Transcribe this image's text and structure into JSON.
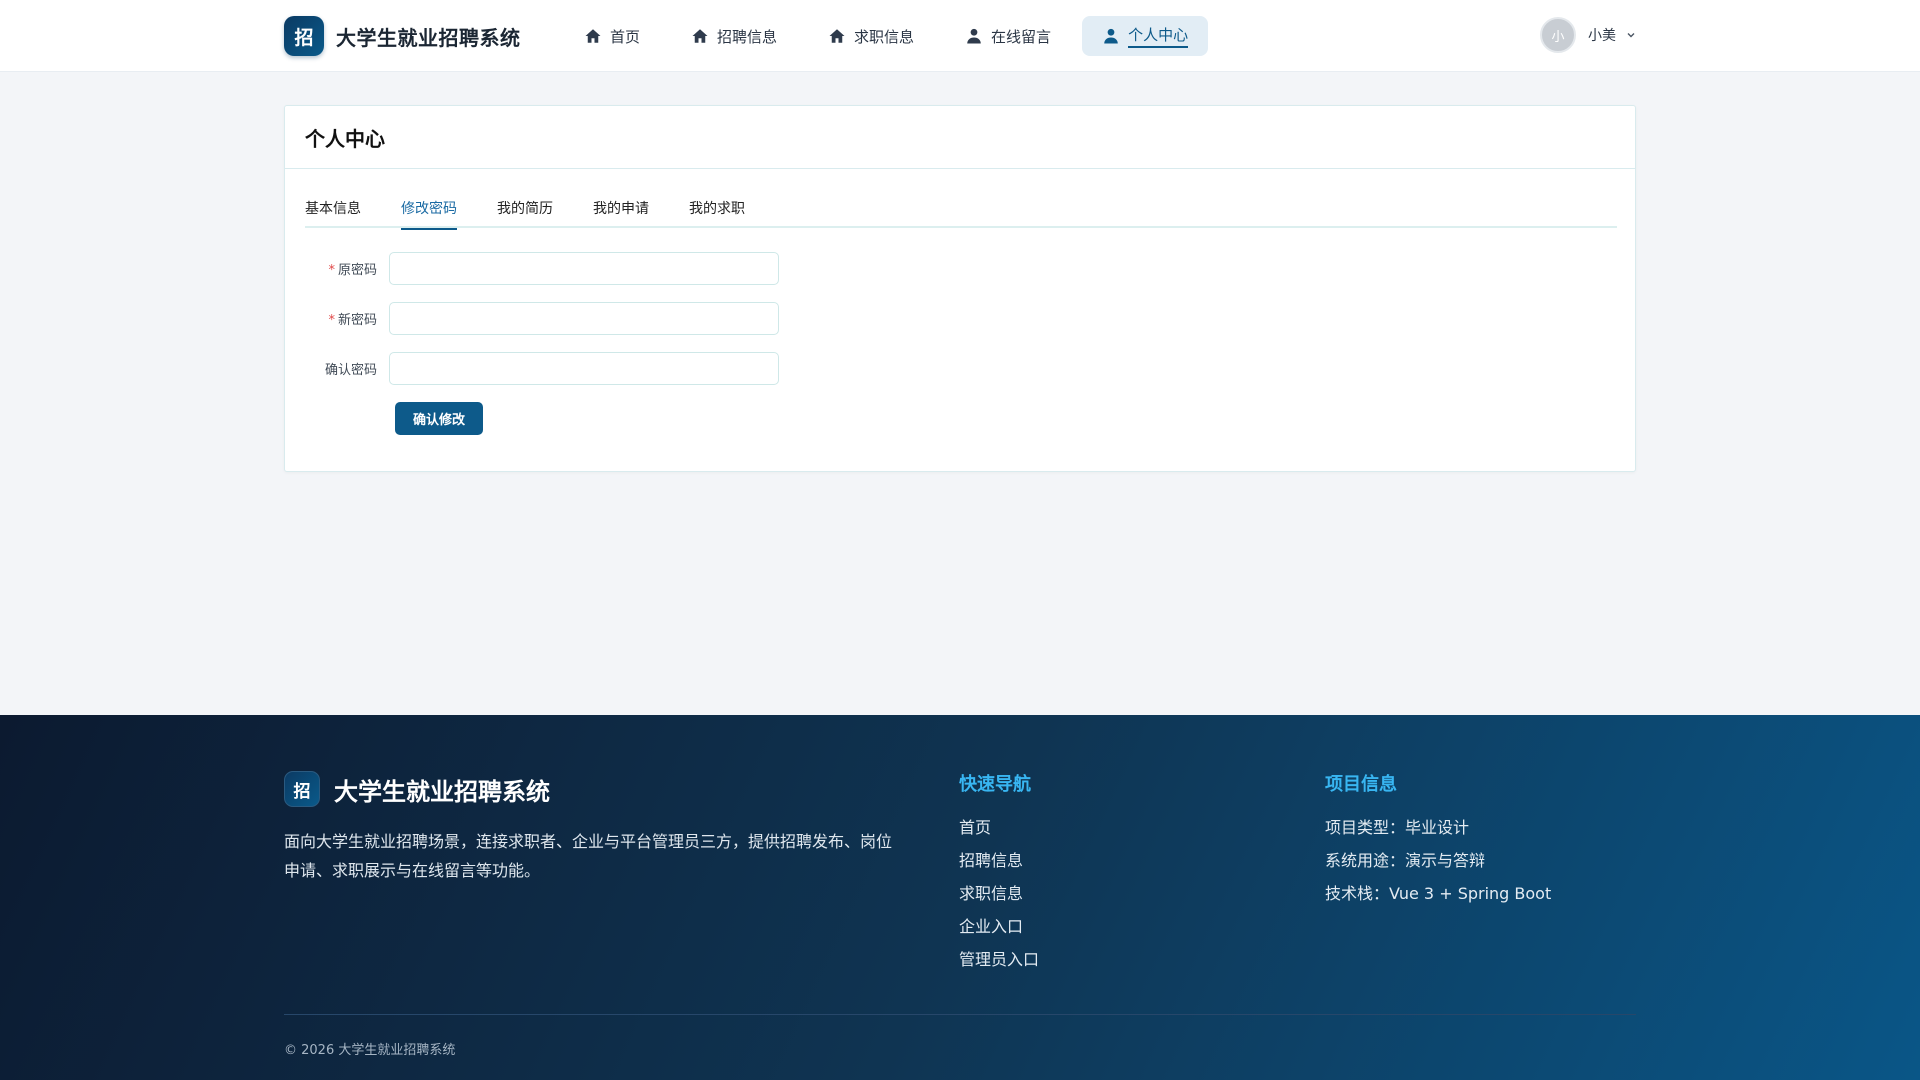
{
  "header": {
    "logo_char": "招",
    "brand": "大学生就业招聘系统",
    "nav": [
      {
        "label": "首页",
        "icon": "home-icon"
      },
      {
        "label": "招聘信息",
        "icon": "home-icon"
      },
      {
        "label": "求职信息",
        "icon": "home-icon"
      },
      {
        "label": "在线留言",
        "icon": "user-icon"
      },
      {
        "label": "个人中心",
        "icon": "user-icon",
        "active": true
      }
    ],
    "user": {
      "avatar_char": "小",
      "name": "小美"
    }
  },
  "card": {
    "title": "个人中心",
    "tabs": [
      {
        "label": "基本信息"
      },
      {
        "label": "修改密码",
        "active": true
      },
      {
        "label": "我的简历"
      },
      {
        "label": "我的申请"
      },
      {
        "label": "我的求职"
      }
    ],
    "form": {
      "old_password_label": "原密码",
      "new_password_label": "新密码",
      "confirm_password_label": "确认密码",
      "required_mark": "*",
      "old_password_value": "",
      "new_password_value": "",
      "confirm_password_value": "",
      "submit_label": "确认修改"
    }
  },
  "footer": {
    "logo_char": "招",
    "brand": "大学生就业招聘系统",
    "description": "面向大学生就业招聘场景，连接求职者、企业与平台管理员三方，提供招聘发布、岗位申请、求职展示与在线留言等功能。",
    "quick_nav": {
      "title": "快速导航",
      "items": [
        "首页",
        "招聘信息",
        "求职信息",
        "企业入口",
        "管理员入口"
      ]
    },
    "project_info": {
      "title": "项目信息",
      "items": [
        "项目类型：毕业设计",
        "系统用途：演示与答辩",
        "技术栈：Vue 3 + Spring Boot"
      ]
    },
    "copyright": "© 2026 大学生就业招聘系统"
  },
  "colors": {
    "primary": "#0d5a8a",
    "accent": "#38b6f2",
    "required": "#e04848"
  }
}
